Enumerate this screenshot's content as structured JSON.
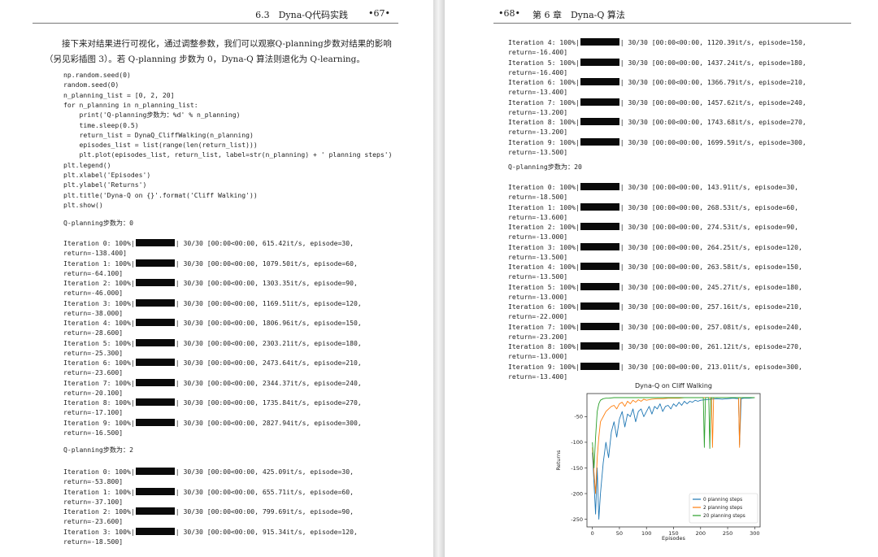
{
  "left": {
    "header": {
      "section": "6.3　Dyna-Q代码实践",
      "page": "•67•"
    },
    "paragraph": "接下来对结果进行可视化，通过调整参数，我们可以观察Q-planning步数对结果的影响（另见彩插图 3）。若 Q-planning 步数为 0，Dyna-Q 算法则退化为 Q-learning。",
    "code": [
      "np.random.seed(0)",
      "random.seed(0)",
      "n_planning_list = [0, 2, 20]",
      "for n_planning in n_planning_list:",
      "    print('Q-planning步数为：%d' % n_planning)",
      "    time.sleep(0.5)",
      "    return_list = DynaQ_CliffWalking(n_planning)",
      "    episodes_list = list(range(len(return_list)))",
      "    plt.plot(episodes_list, return_list, label=str(n_planning) + ' planning steps')",
      "plt.legend()",
      "plt.xlabel('Episodes')",
      "plt.ylabel('Returns')",
      "plt.title('Dyna-Q on {}'.format('Cliff Walking'))",
      "plt.show()"
    ],
    "label0": "Q-planning步数为：0",
    "label2": "Q-planning步数为：2",
    "iters_n0": [
      {
        "pre": "Iteration 0: 100%|",
        "post": "| 30/30 [00:00<00:00, 615.42it/s, episode=30,",
        "ret": "return=-138.400]"
      },
      {
        "pre": "Iteration 1: 100%|",
        "post": "| 30/30 [00:00<00:00, 1079.50it/s, episode=60,",
        "ret": "return=-64.100]"
      },
      {
        "pre": "Iteration 2: 100%|",
        "post": "| 30/30 [00:00<00:00, 1303.35it/s, episode=90,",
        "ret": "return=-46.000]"
      },
      {
        "pre": "Iteration 3: 100%|",
        "post": "| 30/30 [00:00<00:00, 1169.51it/s, episode=120,",
        "ret": "return=-38.000]"
      },
      {
        "pre": "Iteration 4: 100%|",
        "post": "| 30/30 [00:00<00:00, 1806.96it/s, episode=150,",
        "ret": "return=-28.600]"
      },
      {
        "pre": "Iteration 5: 100%|",
        "post": "| 30/30 [00:00<00:00, 2303.21it/s, episode=180,",
        "ret": "return=-25.300]"
      },
      {
        "pre": "Iteration 6: 100%|",
        "post": "| 30/30 [00:00<00:00, 2473.64it/s, episode=210,",
        "ret": "return=-23.600]"
      },
      {
        "pre": "Iteration 7: 100%|",
        "post": "| 30/30 [00:00<00:00, 2344.37it/s, episode=240,",
        "ret": "return=-20.100]"
      },
      {
        "pre": "Iteration 8: 100%|",
        "post": "| 30/30 [00:00<00:00, 1735.84it/s, episode=270,",
        "ret": "return=-17.100]"
      },
      {
        "pre": "Iteration 9: 100%|",
        "post": "| 30/30 [00:00<00:00, 2827.94it/s, episode=300,",
        "ret": "return=-16.500]"
      }
    ],
    "iters_n2": [
      {
        "pre": "Iteration 0: 100%|",
        "post": "| 30/30 [00:00<00:00, 425.09it/s, episode=30,",
        "ret": "return=-53.800]"
      },
      {
        "pre": "Iteration 1: 100%|",
        "post": "| 30/30 [00:00<00:00, 655.71it/s, episode=60,",
        "ret": "return=-37.100]"
      },
      {
        "pre": "Iteration 2: 100%|",
        "post": "| 30/30 [00:00<00:00, 799.69it/s, episode=90,",
        "ret": "return=-23.600]"
      },
      {
        "pre": "Iteration 3: 100%|",
        "post": "| 30/30 [00:00<00:00, 915.34it/s, episode=120,",
        "ret": "return=-18.500]"
      }
    ]
  },
  "right": {
    "header": {
      "page": "•68•",
      "chapter": "第 6 章　Dyna-Q 算法"
    },
    "iters_n2_cont": [
      {
        "pre": "Iteration 4: 100%|",
        "post": "| 30/30 [00:00<00:00, 1120.39it/s, episode=150,",
        "ret": "return=-16.400]"
      },
      {
        "pre": "Iteration 5: 100%|",
        "post": "| 30/30 [00:00<00:00, 1437.24it/s, episode=180,",
        "ret": "return=-16.400]"
      },
      {
        "pre": "Iteration 6: 100%|",
        "post": "| 30/30 [00:00<00:00, 1366.79it/s, episode=210,",
        "ret": "return=-13.400]"
      },
      {
        "pre": "Iteration 7: 100%|",
        "post": "| 30/30 [00:00<00:00, 1457.62it/s, episode=240,",
        "ret": "return=-13.200]"
      },
      {
        "pre": "Iteration 8: 100%|",
        "post": "| 30/30 [00:00<00:00, 1743.68it/s, episode=270,",
        "ret": "return=-13.200]"
      },
      {
        "pre": "Iteration 9: 100%|",
        "post": "| 30/30 [00:00<00:00, 1699.59it/s, episode=300,",
        "ret": "return=-13.500]"
      }
    ],
    "label20": "Q-planning步数为：20",
    "iters_n20": [
      {
        "pre": "Iteration 0: 100%|",
        "post": "| 30/30 [00:00<00:00, 143.91it/s, episode=30,",
        "ret": "return=-18.500]"
      },
      {
        "pre": "Iteration 1: 100%|",
        "post": "| 30/30 [00:00<00:00, 268.53it/s, episode=60,",
        "ret": "return=-13.600]"
      },
      {
        "pre": "Iteration 2: 100%|",
        "post": "| 30/30 [00:00<00:00, 274.53it/s, episode=90,",
        "ret": "return=-13.000]"
      },
      {
        "pre": "Iteration 3: 100%|",
        "post": "| 30/30 [00:00<00:00, 264.25it/s, episode=120,",
        "ret": "return=-13.500]"
      },
      {
        "pre": "Iteration 4: 100%|",
        "post": "| 30/30 [00:00<00:00, 263.58it/s, episode=150,",
        "ret": "return=-13.500]"
      },
      {
        "pre": "Iteration 5: 100%|",
        "post": "| 30/30 [00:00<00:00, 245.27it/s, episode=180,",
        "ret": "return=-13.000]"
      },
      {
        "pre": "Iteration 6: 100%|",
        "post": "| 30/30 [00:00<00:00, 257.16it/s, episode=210,",
        "ret": "return=-22.000]"
      },
      {
        "pre": "Iteration 7: 100%|",
        "post": "| 30/30 [00:00<00:00, 257.08it/s, episode=240,",
        "ret": "return=-23.200]"
      },
      {
        "pre": "Iteration 8: 100%|",
        "post": "| 30/30 [00:00<00:00, 261.12it/s, episode=270,",
        "ret": "return=-13.000]"
      },
      {
        "pre": "Iteration 9: 100%|",
        "post": "| 30/30 [00:00<00:00, 213.01it/s, episode=300,",
        "ret": "return=-13.400]"
      }
    ]
  },
  "chart_data": {
    "type": "line",
    "title": "Dyna-Q on Cliff Walking",
    "xlabel": "Episodes",
    "ylabel": "Returns",
    "xlim": [
      -10,
      310
    ],
    "ylim": [
      -265,
      -5
    ],
    "xticks": [
      0,
      50,
      100,
      150,
      200,
      250,
      300
    ],
    "yticks": [
      -50,
      -100,
      -150,
      -200,
      -250
    ],
    "legend": "bottom-right",
    "grid": false,
    "series": [
      {
        "name": "0 planning steps",
        "color": "#1f77b4",
        "x": [
          0,
          3,
          6,
          9,
          12,
          15,
          20,
          25,
          30,
          35,
          40,
          45,
          50,
          55,
          60,
          65,
          70,
          75,
          80,
          85,
          90,
          95,
          100,
          105,
          110,
          115,
          120,
          125,
          130,
          135,
          140,
          145,
          150,
          155,
          160,
          165,
          170,
          175,
          180,
          185,
          190,
          195,
          200,
          210,
          220,
          230,
          240,
          250,
          260,
          270,
          272,
          275,
          280,
          290,
          300
        ],
        "y": [
          -120,
          -180,
          -240,
          -150,
          -250,
          -200,
          -140,
          -100,
          -130,
          -80,
          -60,
          -90,
          -55,
          -40,
          -70,
          -45,
          -50,
          -35,
          -60,
          -40,
          -35,
          -50,
          -40,
          -30,
          -45,
          -30,
          -35,
          -25,
          -40,
          -30,
          -28,
          -35,
          -25,
          -30,
          -22,
          -28,
          -20,
          -25,
          -20,
          -22,
          -18,
          -20,
          -18,
          -17,
          -16,
          -15,
          -16,
          -15,
          -14,
          -15,
          -105,
          -15,
          -14,
          -14,
          -13
        ]
      },
      {
        "name": "2 planning steps",
        "color": "#ff7f0e",
        "x": [
          0,
          3,
          6,
          9,
          12,
          15,
          20,
          25,
          30,
          35,
          40,
          45,
          50,
          55,
          60,
          65,
          70,
          75,
          80,
          85,
          90,
          95,
          100,
          110,
          120,
          130,
          140,
          150,
          160,
          170,
          180,
          190,
          200,
          210,
          220,
          222,
          224,
          230,
          240,
          250,
          260,
          270,
          272,
          274,
          280,
          290,
          300
        ],
        "y": [
          -110,
          -160,
          -200,
          -130,
          -90,
          -60,
          -50,
          -40,
          -35,
          -30,
          -28,
          -35,
          -25,
          -22,
          -30,
          -20,
          -25,
          -18,
          -22,
          -17,
          -20,
          -16,
          -18,
          -16,
          -15,
          -15,
          -14,
          -14,
          -14,
          -13,
          -13,
          -13,
          -13,
          -13,
          -13,
          -110,
          -13,
          -13,
          -13,
          -13,
          -13,
          -13,
          -110,
          -13,
          -13,
          -13,
          -13
        ]
      },
      {
        "name": "20 planning steps",
        "color": "#2ca02c",
        "x": [
          0,
          3,
          6,
          9,
          12,
          15,
          20,
          25,
          30,
          40,
          50,
          60,
          80,
          100,
          120,
          140,
          160,
          180,
          200,
          205,
          207,
          209,
          215,
          217,
          219,
          225,
          240,
          260,
          280,
          300
        ],
        "y": [
          -100,
          -150,
          -90,
          -40,
          -25,
          -18,
          -15,
          -14,
          -14,
          -13,
          -13,
          -13,
          -13,
          -13,
          -13,
          -13,
          -13,
          -13,
          -13,
          -13,
          -110,
          -13,
          -13,
          -112,
          -13,
          -13,
          -13,
          -13,
          -13,
          -13
        ]
      }
    ]
  }
}
